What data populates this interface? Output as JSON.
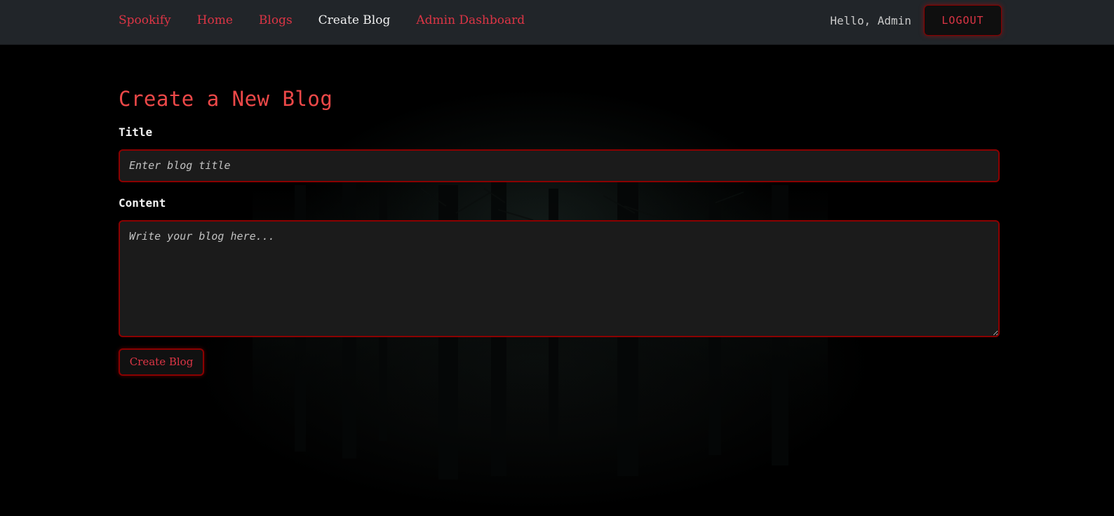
{
  "navbar": {
    "brand": "Spookify",
    "links": [
      "Home",
      "Blogs",
      "Create Blog",
      "Admin Dashboard"
    ],
    "active_link": "Create Blog",
    "greeting": "Hello, Admin",
    "logout_label": "LOGOUT"
  },
  "form": {
    "heading": "Create a New Blog",
    "title_label": "Title",
    "title_placeholder": "Enter blog title",
    "title_value": "",
    "content_label": "Content",
    "content_placeholder": "Write your blog here...",
    "content_value": "",
    "submit_label": "Create Blog"
  },
  "colors": {
    "accent": "#dc3545",
    "heading": "#ec4848",
    "border": "#8b0000",
    "navbar_bg": "#212529",
    "input_bg": "#1b1b1b",
    "page_bg": "#000000"
  }
}
